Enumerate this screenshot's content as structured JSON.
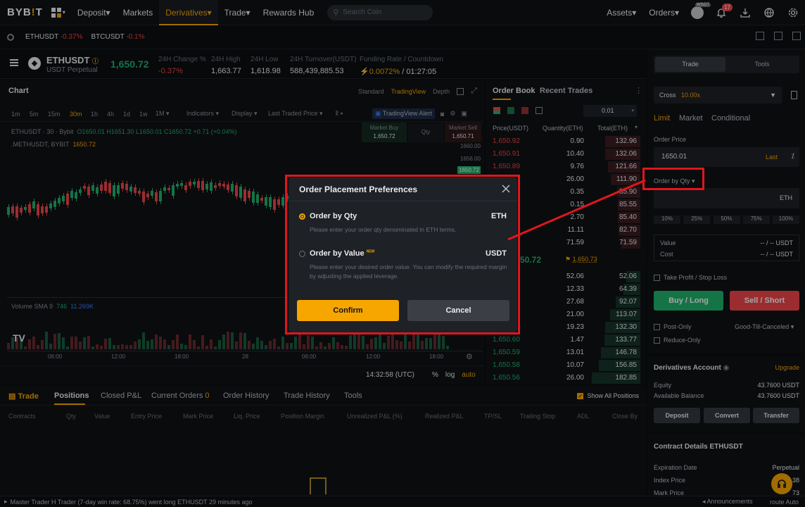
{
  "nav": {
    "logo_left": "BYB",
    "logo_right": "T",
    "items": [
      "Deposit▾",
      "Markets",
      "Derivatives▾",
      "Trade▾",
      "Rewards Hub"
    ],
    "search_placeholder": "Search Coin",
    "assets": "Assets▾",
    "orders": "Orders▾",
    "notif_count": "17",
    "avatar_badge": "WSOT"
  },
  "tickers": [
    {
      "sym": "ETHUSDT",
      "chg": "-0.37%"
    },
    {
      "sym": "BTCUSDT",
      "chg": "-0.1%"
    }
  ],
  "market": {
    "symbol": "ETHUSDT",
    "sub": "USDT Perpetual",
    "last": "1,650.72",
    "stats": [
      {
        "label": "24H Change %",
        "value": "-0.37%"
      },
      {
        "label": "24H High",
        "value": "1,663.77"
      },
      {
        "label": "24H Low",
        "value": "1,618.98"
      },
      {
        "label": "24H Turnover(USDT)",
        "value": "588,439,885.53"
      },
      {
        "label": "Funding Rate / Countdown",
        "value": "0.0072%",
        "countdown": "/ 01:27:05"
      }
    ]
  },
  "chart": {
    "title": "Chart",
    "views": [
      "Standard",
      "TradingView",
      "Depth"
    ],
    "intervals": [
      "1m",
      "5m",
      "15m",
      "30m",
      "1h",
      "4h",
      "1d",
      "1w",
      "1M ▾"
    ],
    "tools": [
      "Indicators ▾",
      "Display ▾",
      "Last Traded Price ▾"
    ],
    "tv_alert": "TradingView Alert",
    "legend1_sym": "ETHUSDT · 30 · Bybit",
    "legend1_vals": "O1650.01 H1651.30 L1650.01 C1650.72 +0.71 (+0.04%)",
    "legend2_sym": ".METHUSDT, BYBIT",
    "legend2_val": "1650.72",
    "volume_label": "Volume SMA 9",
    "volume_v1": "746",
    "volume_v2": "11.269K",
    "market_buy": "Market Buy",
    "market_buy_val": "1,650.72",
    "qty_placeholder": "Qty",
    "market_sell": "Market Sell",
    "market_sell_val": "1,650.71",
    "price_axis": [
      "1660.00",
      "1656.00",
      "1650.72"
    ],
    "time_axis": [
      "06:00",
      "12:00",
      "18:00",
      "28",
      "06:00",
      "12:00",
      "18:00"
    ],
    "clock": "14:32:58 (UTC)",
    "scale_opts": [
      "%",
      "log",
      "auto"
    ]
  },
  "orderbook": {
    "tabs": [
      "Order Book",
      "Recent Trades"
    ],
    "precision": "0.01",
    "headers": [
      "Price(USDT)",
      "Quantity(ETH)",
      "Total(ETH)"
    ],
    "asks": [
      {
        "p": "1,650.92",
        "q": "0.90",
        "t": "132.96"
      },
      {
        "p": "1,650.91",
        "q": "10.40",
        "t": "132.06"
      },
      {
        "p": "1,650.89",
        "q": "9.76",
        "t": "121.66"
      },
      {
        "p": "",
        "q": "26.00",
        "t": "111.90"
      },
      {
        "p": "",
        "q": "0.35",
        "t": "85.90"
      },
      {
        "p": "",
        "q": "0.15",
        "t": "85.55"
      },
      {
        "p": "",
        "q": "2.70",
        "t": "85.40"
      },
      {
        "p": "",
        "q": "11.11",
        "t": "82.70"
      },
      {
        "p": "",
        "q": "71.59",
        "t": "71.59"
      }
    ],
    "mid_price": "50.72",
    "mark_price": "1,650.73",
    "bids": [
      {
        "p": "",
        "q": "52.06",
        "t": "52.06"
      },
      {
        "p": "",
        "q": "12.33",
        "t": "64.39"
      },
      {
        "p": "",
        "q": "27.68",
        "t": "92.07"
      },
      {
        "p": "",
        "q": "21.00",
        "t": "113.07"
      },
      {
        "p": "",
        "q": "19.23",
        "t": "132.30"
      },
      {
        "p": "1,650.60",
        "q": "1.47",
        "t": "133.77"
      },
      {
        "p": "1,650.59",
        "q": "13.01",
        "t": "146.78"
      },
      {
        "p": "1,650.58",
        "q": "10.07",
        "t": "156.85"
      },
      {
        "p": "1,650.56",
        "q": "26.00",
        "t": "182.85"
      }
    ]
  },
  "trade": {
    "tabs": [
      "Trade",
      "Tools"
    ],
    "margin_mode": "Cross",
    "leverage": "10.00x",
    "order_types": [
      "Limit",
      "Market",
      "Conditional"
    ],
    "order_price_label": "Order Price",
    "order_price": "1650.01",
    "last_label": "Last",
    "order_by_label": "Order by Qty ▾",
    "qty_unit": "ETH",
    "percents": [
      "10%",
      "25%",
      "50%",
      "75%",
      "100%"
    ],
    "value_label": "Value",
    "cost_label": "Cost",
    "value_val": "-- / -- USDT",
    "cost_val": "-- / -- USDT",
    "tpsl": "Take Profit / Stop Loss",
    "buy": "Buy / Long",
    "sell": "Sell / Short",
    "post_only": "Post-Only",
    "tif": "Good-Till-Canceled ▾",
    "reduce_only": "Reduce-Only",
    "account_title": "Derivatives Account",
    "upgrade": "Upgrade",
    "equity_label": "Equity",
    "equity": "43.7600 USDT",
    "avail_label": "Available Balance",
    "avail": "43.7600 USDT",
    "actions": [
      "Deposit",
      "Convert",
      "Transfer"
    ],
    "contract_title": "Contract Details ETHUSDT",
    "exp_label": "Expiration Date",
    "exp_val": "Perpetual",
    "index_label": "Index Price",
    "index_val": "38",
    "mark_label": "Mark Price",
    "mark_val": "73"
  },
  "bottom": {
    "tabs": [
      "Trade",
      "Positions",
      "Closed P&L",
      "Current Orders",
      "Order History",
      "Trade History",
      "Tools"
    ],
    "orders_count": "0",
    "show_all": "Show All Positions",
    "columns": [
      "Contracts",
      "Qty",
      "Value",
      "Entry Price",
      "Mark Price",
      "Liq. Price",
      "Position Margin",
      "Unrealized P&L (%)",
      "Realized P&L",
      "TP/SL",
      "Trailing Stop",
      "ADL",
      "Close By"
    ]
  },
  "footer": {
    "message": "Master Trader H Trader (7-day win rate: 68.75%) went long ETHUSDT 29 minutes ago",
    "announcements": "Announcements",
    "route": "route Auto"
  },
  "modal": {
    "title": "Order Placement Preferences",
    "opt1_title": "Order by Qty",
    "opt1_unit": "ETH",
    "opt1_desc": "Please enter your order qty denominated in ETH terms.",
    "opt2_title": "Order by Value",
    "opt2_badge": "NEW",
    "opt2_unit": "USDT",
    "opt2_desc": "Please enter your desired order value. You can modify the required margin by adjusting the applied leverage.",
    "confirm": "Confirm",
    "cancel": "Cancel"
  },
  "colors": {
    "accent": "#f7a600",
    "green": "#20b26c",
    "red": "#ef454a",
    "annotation": "#e0161d"
  }
}
